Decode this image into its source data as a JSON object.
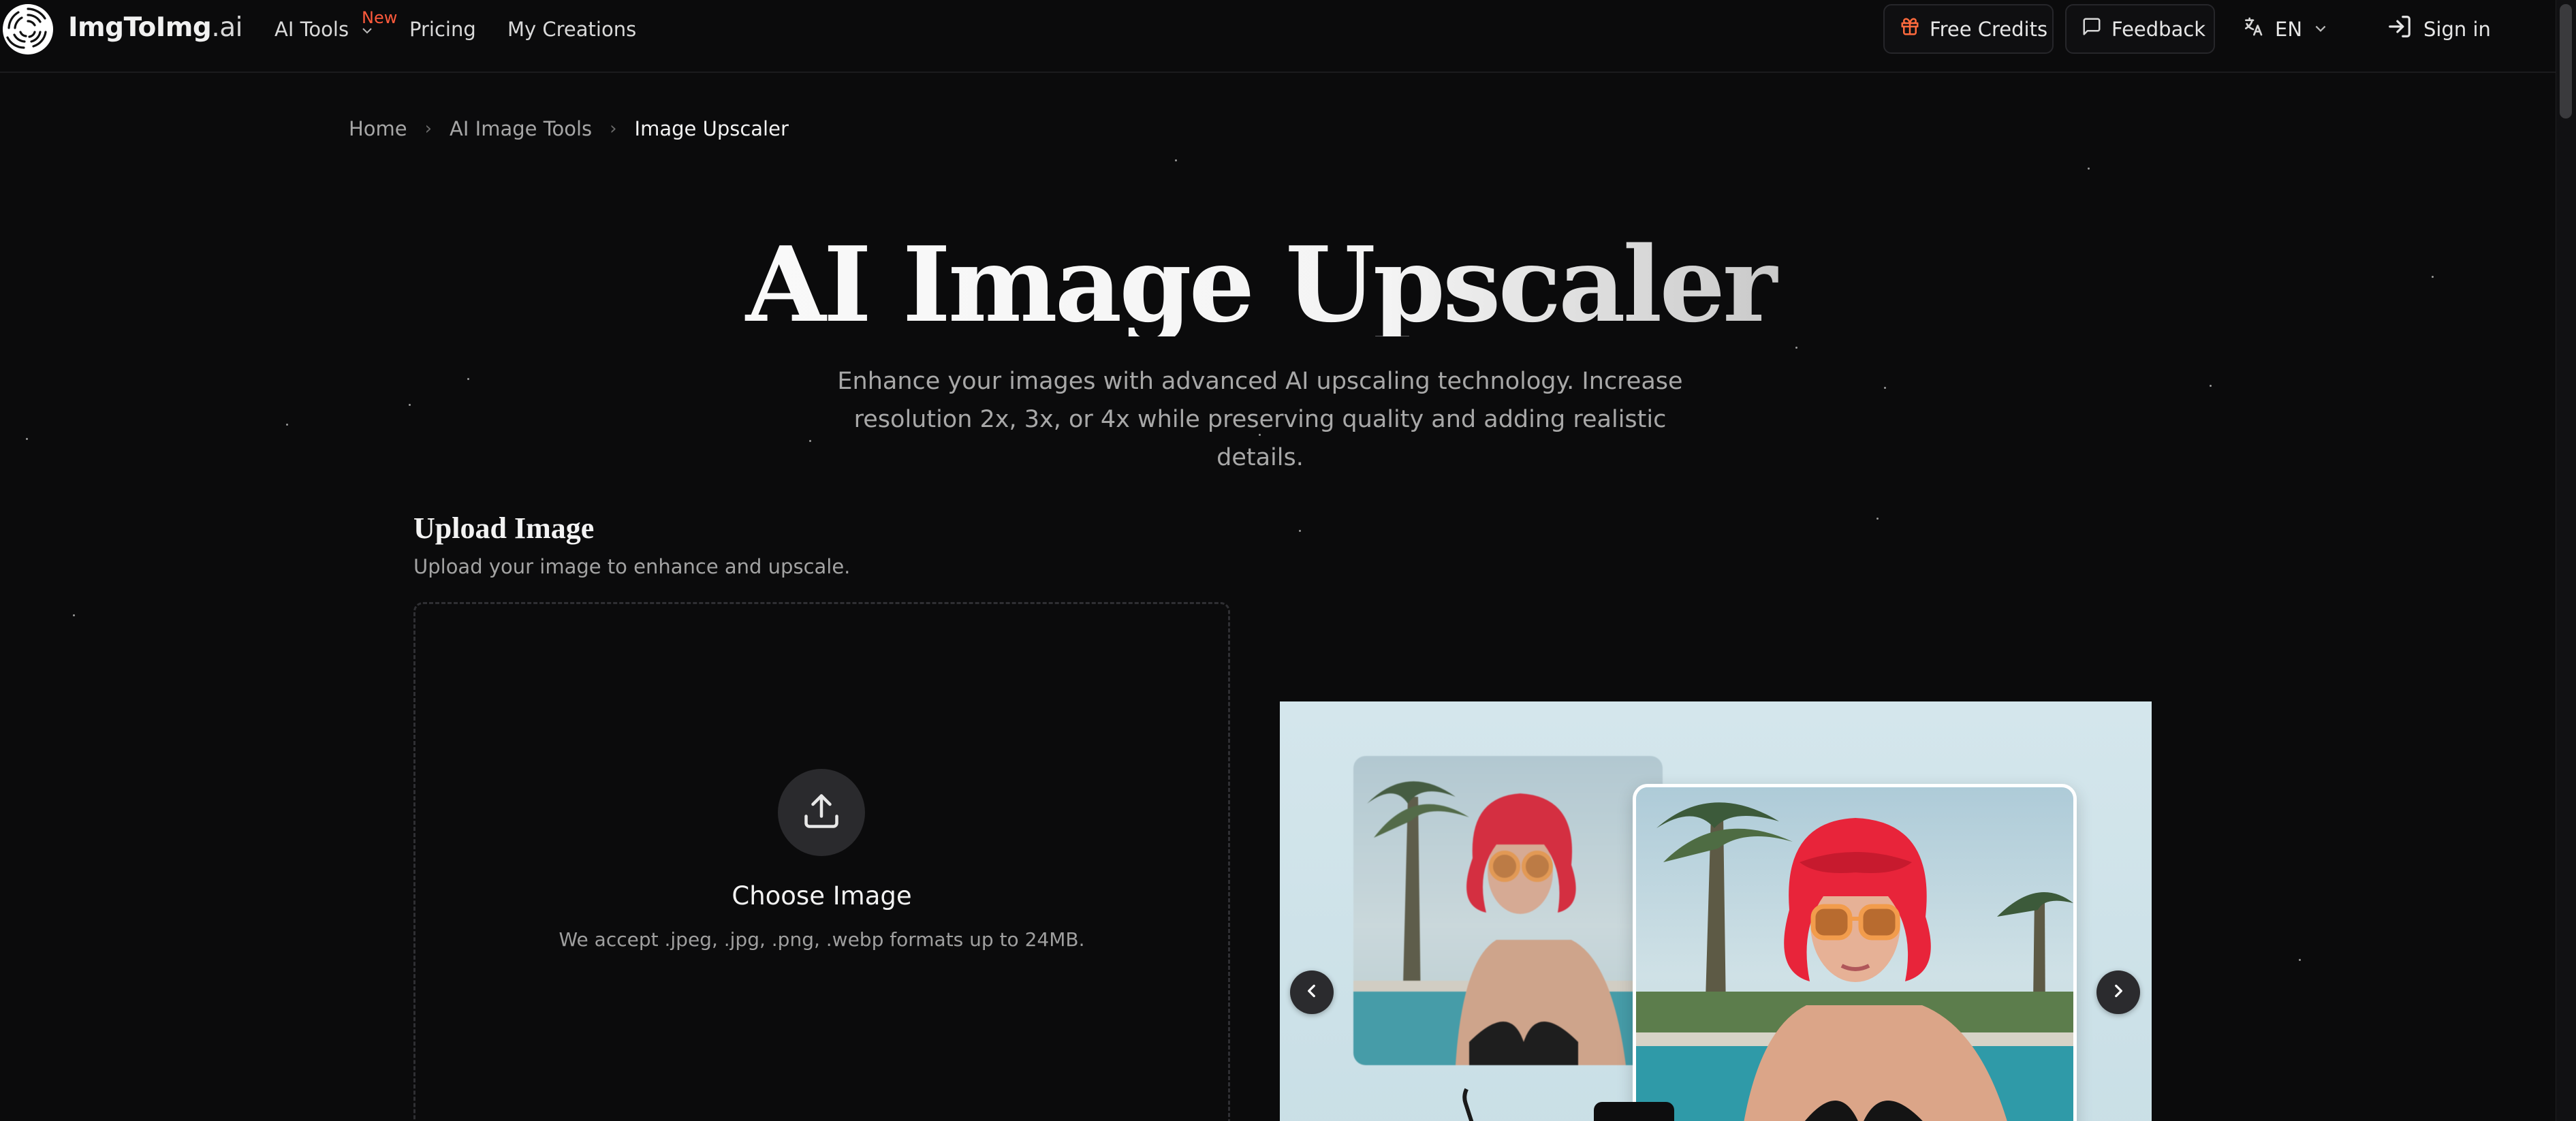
{
  "header": {
    "logo_text": "ImgToImg",
    "logo_suffix": ".ai",
    "nav": [
      {
        "label": "AI Tools",
        "badge": "New"
      },
      {
        "label": "Pricing"
      },
      {
        "label": "My Creations"
      }
    ],
    "free_credits_label": "Free Credits",
    "feedback_label": "Feedback",
    "language_label": "EN",
    "sign_in_label": "Sign in"
  },
  "breadcrumb": [
    "Home",
    "AI Image Tools",
    "Image Upscaler"
  ],
  "hero": {
    "title": "AI Image Upscaler",
    "subtitle": "Enhance your images with advanced AI upscaling technology. Increase resolution 2x, 3x, or 4x while preserving quality and adding realistic details."
  },
  "upload": {
    "title": "Upload Image",
    "description": "Upload your image to enhance and upscale.",
    "choose_label": "Choose Image",
    "accept_label": "We accept .jpeg, .jpg, .png, .webp formats up to 24MB."
  },
  "colors": {
    "background": "#0b0b0c",
    "accent_badge": "#ff5a3c",
    "gift_icon": "#ff6a3d",
    "showcase_bg": "#d4e6ec",
    "hair_red": "#e8243a"
  },
  "icons": [
    "logo-swirl-icon",
    "chevron-down-icon",
    "gift-icon",
    "message-square-icon",
    "translate-icon",
    "sign-in-icon",
    "chevron-right-icon",
    "upload-icon",
    "chevron-left-icon"
  ]
}
